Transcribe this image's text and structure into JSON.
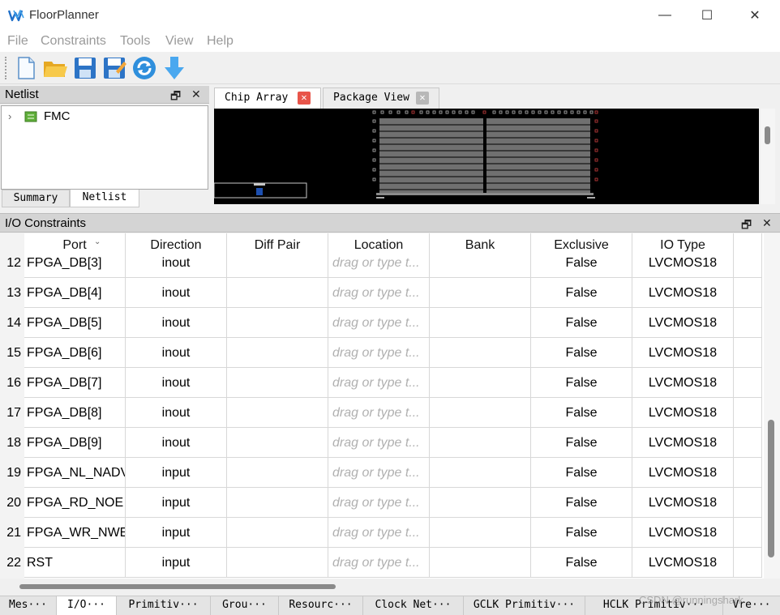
{
  "window": {
    "title": "FloorPlanner",
    "minimize": "—",
    "maximize": "☐",
    "close": "✕"
  },
  "menu": [
    "File",
    "Constraints",
    "Tools",
    "View",
    "Help"
  ],
  "toolbar": {
    "icons": [
      "new-file-icon",
      "open-folder-icon",
      "save-icon",
      "save-as-icon",
      "refresh-icon",
      "download-icon"
    ]
  },
  "netlist_panel": {
    "title": "Netlist",
    "float_glyph": "🗗",
    "close_glyph": "✕",
    "tree": [
      {
        "label": "FMC",
        "expander": "›"
      }
    ],
    "tabs": [
      "Summary",
      "Netlist"
    ]
  },
  "chip_panel": {
    "tabs": [
      {
        "label": "Chip Array",
        "close": "✕"
      },
      {
        "label": "Package View",
        "close": "✕"
      }
    ]
  },
  "io_panel": {
    "title": "I/O Constraints",
    "float_glyph": "🗗",
    "close_glyph": "✕",
    "columns": [
      "Port",
      "Direction",
      "Diff Pair",
      "Location",
      "Bank",
      "Exclusive",
      "IO Type"
    ],
    "sort_caret": "⌄",
    "first_row_partial": {
      "num": "12",
      "port": "FPGA_DB[3]",
      "direction": "inout",
      "diff": "",
      "location": "drag or type t...",
      "bank": "",
      "exclusive": "False",
      "iotype": "LVCMOS18"
    },
    "rows": [
      {
        "num": "13",
        "port": "FPGA_DB[4]",
        "direction": "inout",
        "diff": "",
        "location": "drag or type t...",
        "bank": "",
        "exclusive": "False",
        "iotype": "LVCMOS18"
      },
      {
        "num": "14",
        "port": "FPGA_DB[5]",
        "direction": "inout",
        "diff": "",
        "location": "drag or type t...",
        "bank": "",
        "exclusive": "False",
        "iotype": "LVCMOS18"
      },
      {
        "num": "15",
        "port": "FPGA_DB[6]",
        "direction": "inout",
        "diff": "",
        "location": "drag or type t...",
        "bank": "",
        "exclusive": "False",
        "iotype": "LVCMOS18"
      },
      {
        "num": "16",
        "port": "FPGA_DB[7]",
        "direction": "inout",
        "diff": "",
        "location": "drag or type t...",
        "bank": "",
        "exclusive": "False",
        "iotype": "LVCMOS18"
      },
      {
        "num": "17",
        "port": "FPGA_DB[8]",
        "direction": "inout",
        "diff": "",
        "location": "drag or type t...",
        "bank": "",
        "exclusive": "False",
        "iotype": "LVCMOS18"
      },
      {
        "num": "18",
        "port": "FPGA_DB[9]",
        "direction": "inout",
        "diff": "",
        "location": "drag or type t...",
        "bank": "",
        "exclusive": "False",
        "iotype": "LVCMOS18"
      },
      {
        "num": "19",
        "port": "FPGA_NL_NADV",
        "direction": "input",
        "diff": "",
        "location": "drag or type t...",
        "bank": "",
        "exclusive": "False",
        "iotype": "LVCMOS18"
      },
      {
        "num": "20",
        "port": "FPGA_RD_NOE",
        "direction": "input",
        "diff": "",
        "location": "drag or type t...",
        "bank": "",
        "exclusive": "False",
        "iotype": "LVCMOS18"
      },
      {
        "num": "21",
        "port": "FPGA_WR_NWE",
        "direction": "input",
        "diff": "",
        "location": "drag or type t...",
        "bank": "",
        "exclusive": "False",
        "iotype": "LVCMOS18"
      },
      {
        "num": "22",
        "port": "RST",
        "direction": "input",
        "diff": "",
        "location": "drag or type t...",
        "bank": "",
        "exclusive": "False",
        "iotype": "LVCMOS18"
      }
    ]
  },
  "bottom_tabs": [
    "Mes···",
    "I/O···",
    "Primitiv···",
    "Grou···",
    "Resourc···",
    "Clock Net···",
    "GCLK Primitiv···",
    "HCLK Primitiv···",
    "Vre···"
  ],
  "watermark": "CSDN @runningshark",
  "colors": {
    "tab_close_active": "#e8554a",
    "tab_close_inactive": "#b8b8b8",
    "chip_bg": "#000000",
    "placeholder": "#b0b0b0"
  }
}
